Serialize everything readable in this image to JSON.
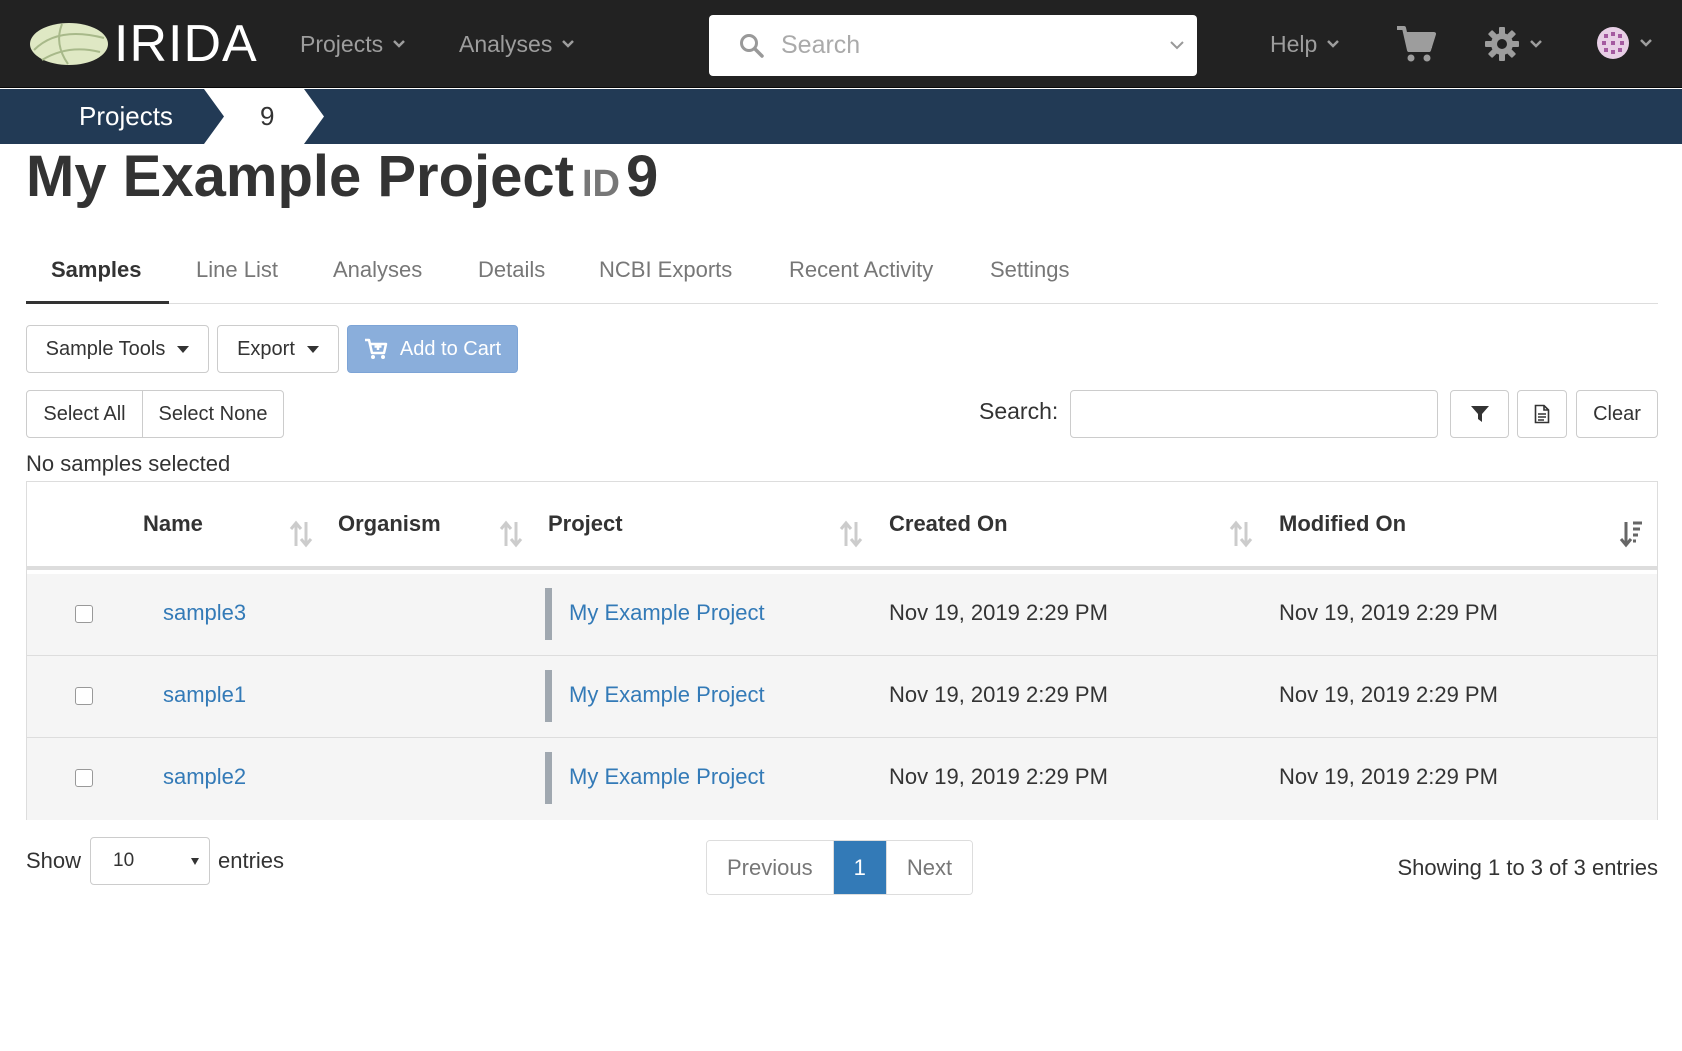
{
  "navbar": {
    "brand": "IRIDA",
    "projects_label": "Projects",
    "analyses_label": "Analyses",
    "search_placeholder": "Search",
    "help_label": "Help"
  },
  "breadcrumb": {
    "root": "Projects",
    "current": "9"
  },
  "project": {
    "name": "My Example Project",
    "id_label": "ID",
    "id_value": "9"
  },
  "tabs": [
    "Samples",
    "Line List",
    "Analyses",
    "Details",
    "NCBI Exports",
    "Recent Activity",
    "Settings"
  ],
  "active_tab": "Samples",
  "toolbar": {
    "sample_tools": "Sample Tools",
    "export": "Export",
    "add_to_cart": "Add to Cart",
    "select_all": "Select All",
    "select_none": "Select None",
    "search_label": "Search:",
    "search_value": "",
    "clear": "Clear"
  },
  "selection_status": "No samples selected",
  "table": {
    "columns": [
      "Name",
      "Organism",
      "Project",
      "Created On",
      "Modified On"
    ],
    "sorted_column": "Modified On",
    "rows": [
      {
        "name": "sample3",
        "organism": "",
        "project": "My Example Project",
        "created": "Nov 19, 2019 2:29 PM",
        "modified": "Nov 19, 2019 2:29 PM"
      },
      {
        "name": "sample1",
        "organism": "",
        "project": "My Example Project",
        "created": "Nov 19, 2019 2:29 PM",
        "modified": "Nov 19, 2019 2:29 PM"
      },
      {
        "name": "sample2",
        "organism": "",
        "project": "My Example Project",
        "created": "Nov 19, 2019 2:29 PM",
        "modified": "Nov 19, 2019 2:29 PM"
      }
    ]
  },
  "footer": {
    "show_label": "Show",
    "page_length": "10",
    "entries_label": "entries",
    "previous": "Previous",
    "current_page": "1",
    "next": "Next",
    "info": "Showing 1 to 3 of 3 entries"
  },
  "icons": {
    "search": "search-icon",
    "cart": "cart-icon",
    "gear": "gear-icon",
    "avatar": "avatar",
    "filter": "filter-icon",
    "document": "file-icon"
  },
  "colors": {
    "navbar_bg": "#222222",
    "breadcrumb_bg": "#223a55",
    "link": "#337ab7",
    "primary_disabled": "#8aaedb"
  }
}
